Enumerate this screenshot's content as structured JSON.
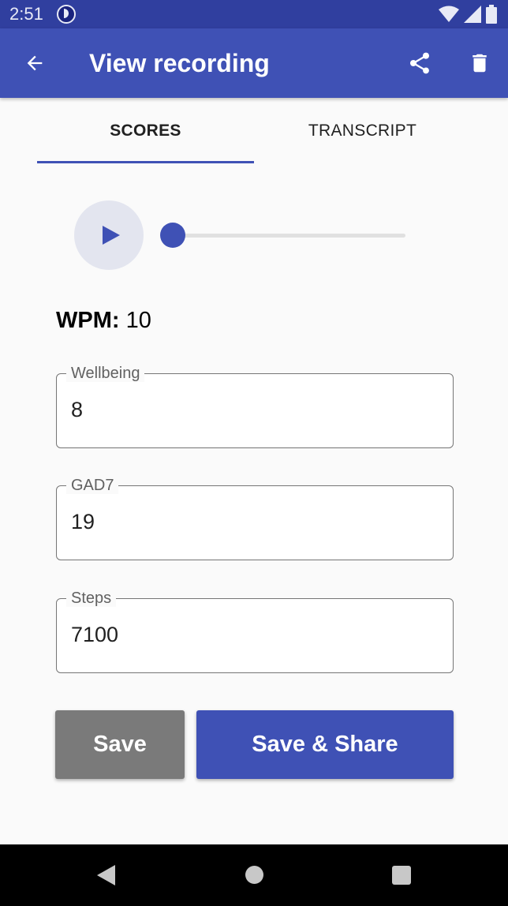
{
  "status_bar": {
    "time": "2:51",
    "icons": [
      "app-notification-icon",
      "wifi-icon",
      "signal-icon",
      "battery-icon"
    ]
  },
  "app_bar": {
    "title": "View recording",
    "icons": [
      "back-arrow-icon",
      "share-icon",
      "trash-icon"
    ]
  },
  "tabs": [
    {
      "label": "SCORES",
      "selected": true
    },
    {
      "label": "TRANSCRIPT",
      "selected": false
    }
  ],
  "player": {
    "play_icon": "play-icon",
    "progress_fraction": 0
  },
  "wpm": {
    "label": "WPM:",
    "value": "10"
  },
  "fields": [
    {
      "label": "Wellbeing",
      "value": "8"
    },
    {
      "label": "GAD7",
      "value": "19"
    },
    {
      "label": "Steps",
      "value": "7100"
    }
  ],
  "buttons": {
    "save_label": "Save",
    "save_share_label": "Save & Share"
  },
  "nav_bar": {
    "icons": [
      "nav-back-icon",
      "nav-home-icon",
      "nav-recents-icon"
    ]
  },
  "colors": {
    "primary": "#3f51b5",
    "primary_dark": "#303f9f",
    "save_button": "#7a7a7a",
    "play_button_bg": "#e3e5ef"
  }
}
